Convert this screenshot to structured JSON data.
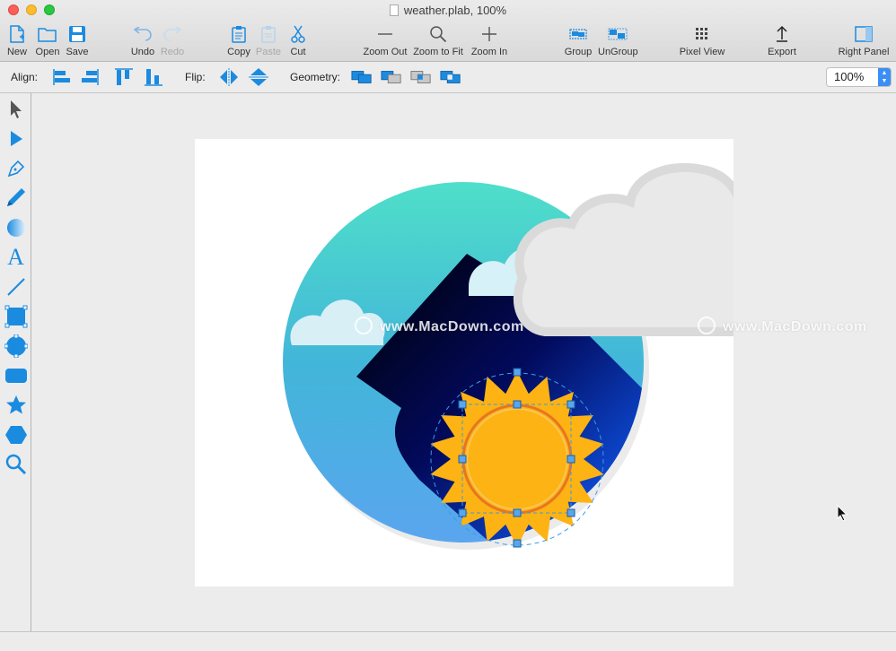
{
  "window": {
    "title": "weather.plab, 100%"
  },
  "toolbar": {
    "new": "New",
    "open": "Open",
    "save": "Save",
    "undo": "Undo",
    "redo": "Redo",
    "copy": "Copy",
    "paste": "Paste",
    "cut": "Cut",
    "zoom_out": "Zoom Out",
    "zoom_to_fit": "Zoom to Fit",
    "zoom_in": "Zoom In",
    "group": "Group",
    "ungroup": "UnGroup",
    "pixel_view": "Pixel View",
    "export": "Export",
    "right_panel": "Right Panel"
  },
  "alignbar": {
    "align_label": "Align:",
    "flip_label": "Flip:",
    "geometry_label": "Geometry:",
    "zoom_value": "100%"
  },
  "tools": [
    "select-arrow-icon",
    "direct-select-icon",
    "pen-icon",
    "pencil-icon",
    "gradient-icon",
    "text-icon",
    "line-icon",
    "rectangle-tool-icon",
    "oval-icon",
    "rounded-rect-icon",
    "star-icon",
    "polygon-icon",
    "zoom-tool-icon"
  ],
  "text_tool_glyph": "A",
  "canvas": {
    "watermark_1": "www.MacDown.com",
    "watermark_2": "www.MacDown.com"
  },
  "colors": {
    "accent": "#1b8be0",
    "sun": "#fdb313",
    "sun_ring": "#e87522",
    "circle_top": "#4fdfc9",
    "circle_bottom": "#5aa5ef",
    "cloud": "#e9e9e9"
  }
}
